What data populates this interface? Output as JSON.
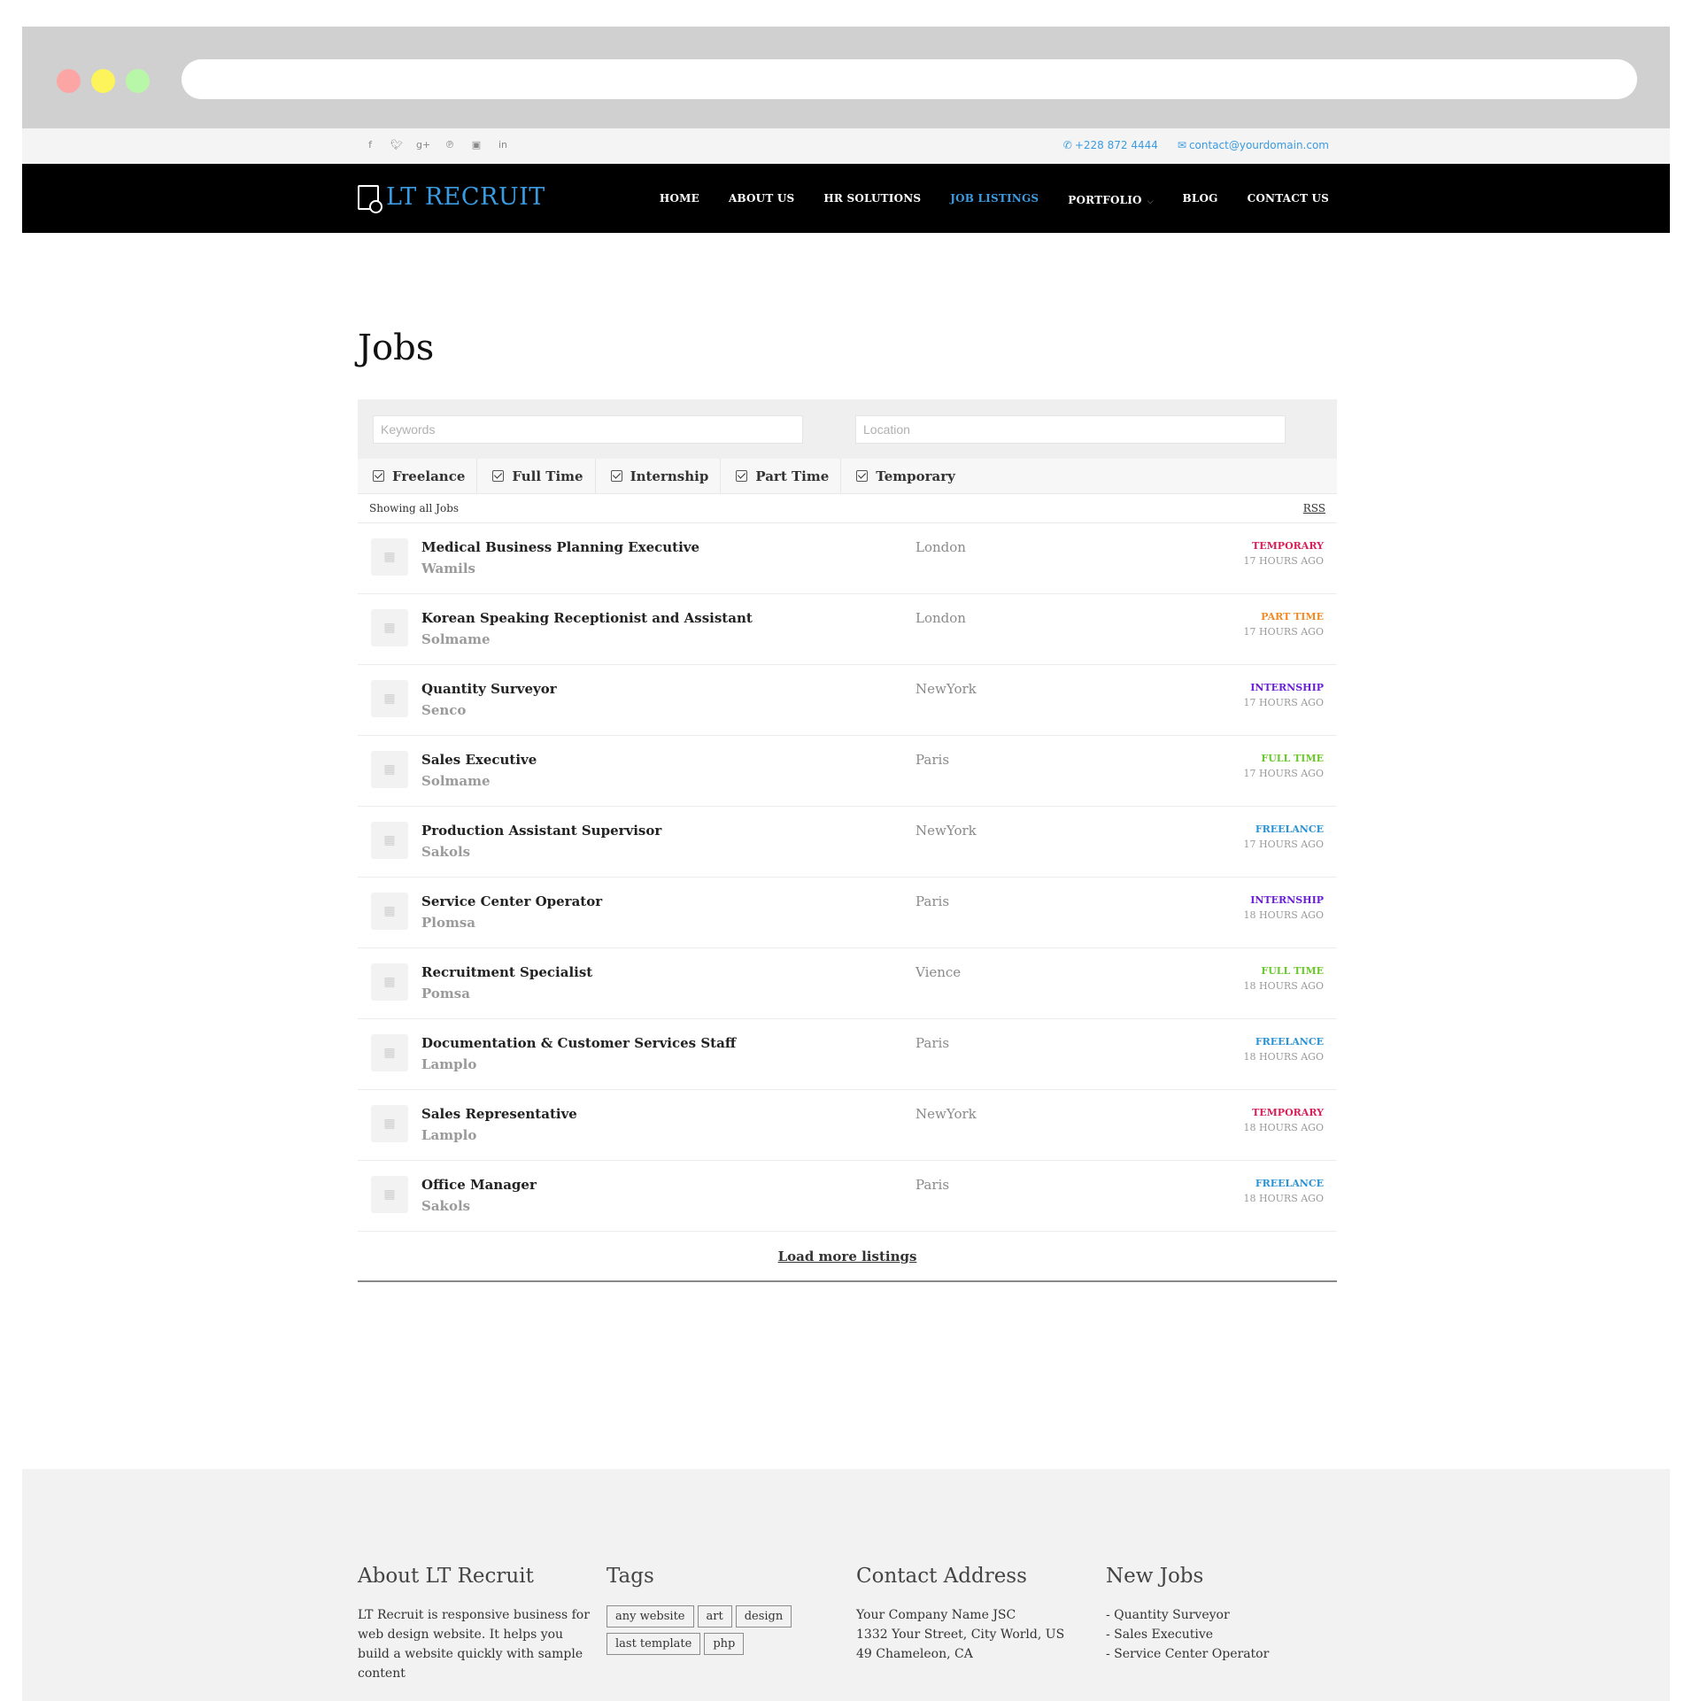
{
  "topbar": {
    "phone": "+228 872 4444",
    "email": "contact@yourdomain.com"
  },
  "brand": {
    "logo_text": "LT  RECRUIT"
  },
  "nav": [
    {
      "label": "HOME"
    },
    {
      "label": "ABOUT US"
    },
    {
      "label": "HR SOLUTIONS"
    },
    {
      "label": "JOB LISTINGS"
    },
    {
      "label": "PORTFOLIO"
    },
    {
      "label": "BLOG"
    },
    {
      "label": "CONTACT US"
    }
  ],
  "page": {
    "title": "Jobs"
  },
  "search": {
    "keywords_placeholder": "Keywords",
    "location_placeholder": "Location"
  },
  "filters": [
    {
      "label": "Freelance",
      "checked": true
    },
    {
      "label": "Full Time",
      "checked": true
    },
    {
      "label": "Internship",
      "checked": true
    },
    {
      "label": "Part Time",
      "checked": true
    },
    {
      "label": "Temporary",
      "checked": true
    }
  ],
  "listing": {
    "showing_text": "Showing all Jobs",
    "rss_label": "RSS",
    "load_more": "Load more listings"
  },
  "type_colors": {
    "TEMPORARY": "#d6215b",
    "PART TIME": "#f08a24",
    "INTERNSHIP": "#6a1ed8",
    "FULL TIME": "#6cc92b",
    "FREELANCE": "#2a93d5"
  },
  "jobs": [
    {
      "title": "Medical Business Planning Executive",
      "company": "Wamils",
      "location": "London",
      "type": "TEMPORARY",
      "posted": "17 HOURS AGO"
    },
    {
      "title": "Korean Speaking Receptionist and Assistant",
      "company": "Solmame",
      "location": "London",
      "type": "PART TIME",
      "posted": "17 HOURS AGO"
    },
    {
      "title": "Quantity Surveyor",
      "company": "Senco",
      "location": "NewYork",
      "type": "INTERNSHIP",
      "posted": "17 HOURS AGO"
    },
    {
      "title": "Sales Executive",
      "company": "Solmame",
      "location": "Paris",
      "type": "FULL TIME",
      "posted": "17 HOURS AGO"
    },
    {
      "title": "Production Assistant Supervisor",
      "company": "Sakols",
      "location": "NewYork",
      "type": "FREELANCE",
      "posted": "17 HOURS AGO"
    },
    {
      "title": "Service Center Operator",
      "company": "Plomsa",
      "location": "Paris",
      "type": "INTERNSHIP",
      "posted": "18 HOURS AGO"
    },
    {
      "title": "Recruitment Specialist",
      "company": "Pomsa",
      "location": "Vience",
      "type": "FULL TIME",
      "posted": "18 HOURS AGO"
    },
    {
      "title": "Documentation & Customer Services Staff",
      "company": "Lamplo",
      "location": "Paris",
      "type": "FREELANCE",
      "posted": "18 HOURS AGO"
    },
    {
      "title": "Sales Representative",
      "company": "Lamplo",
      "location": "NewYork",
      "type": "TEMPORARY",
      "posted": "18 HOURS AGO"
    },
    {
      "title": "Office Manager",
      "company": "Sakols",
      "location": "Paris",
      "type": "FREELANCE",
      "posted": "18 HOURS AGO"
    }
  ],
  "footer": {
    "about": {
      "heading": "About LT Recruit",
      "text": "LT Recruit is responsive business for web design website. It helps you build a website quickly with sample content"
    },
    "tags": {
      "heading": "Tags",
      "items": [
        "any website",
        "art",
        "design",
        "last template",
        "php"
      ]
    },
    "contact": {
      "heading": "Contact Address",
      "lines": [
        "Your Company Name JSC",
        "1332 Your Street, City World, US",
        "49 Chameleon, CA"
      ]
    },
    "new_jobs": {
      "heading": "New Jobs",
      "items": [
        "- Quantity Surveyor",
        "- Sales Executive",
        "- Service Center Operator"
      ]
    }
  }
}
